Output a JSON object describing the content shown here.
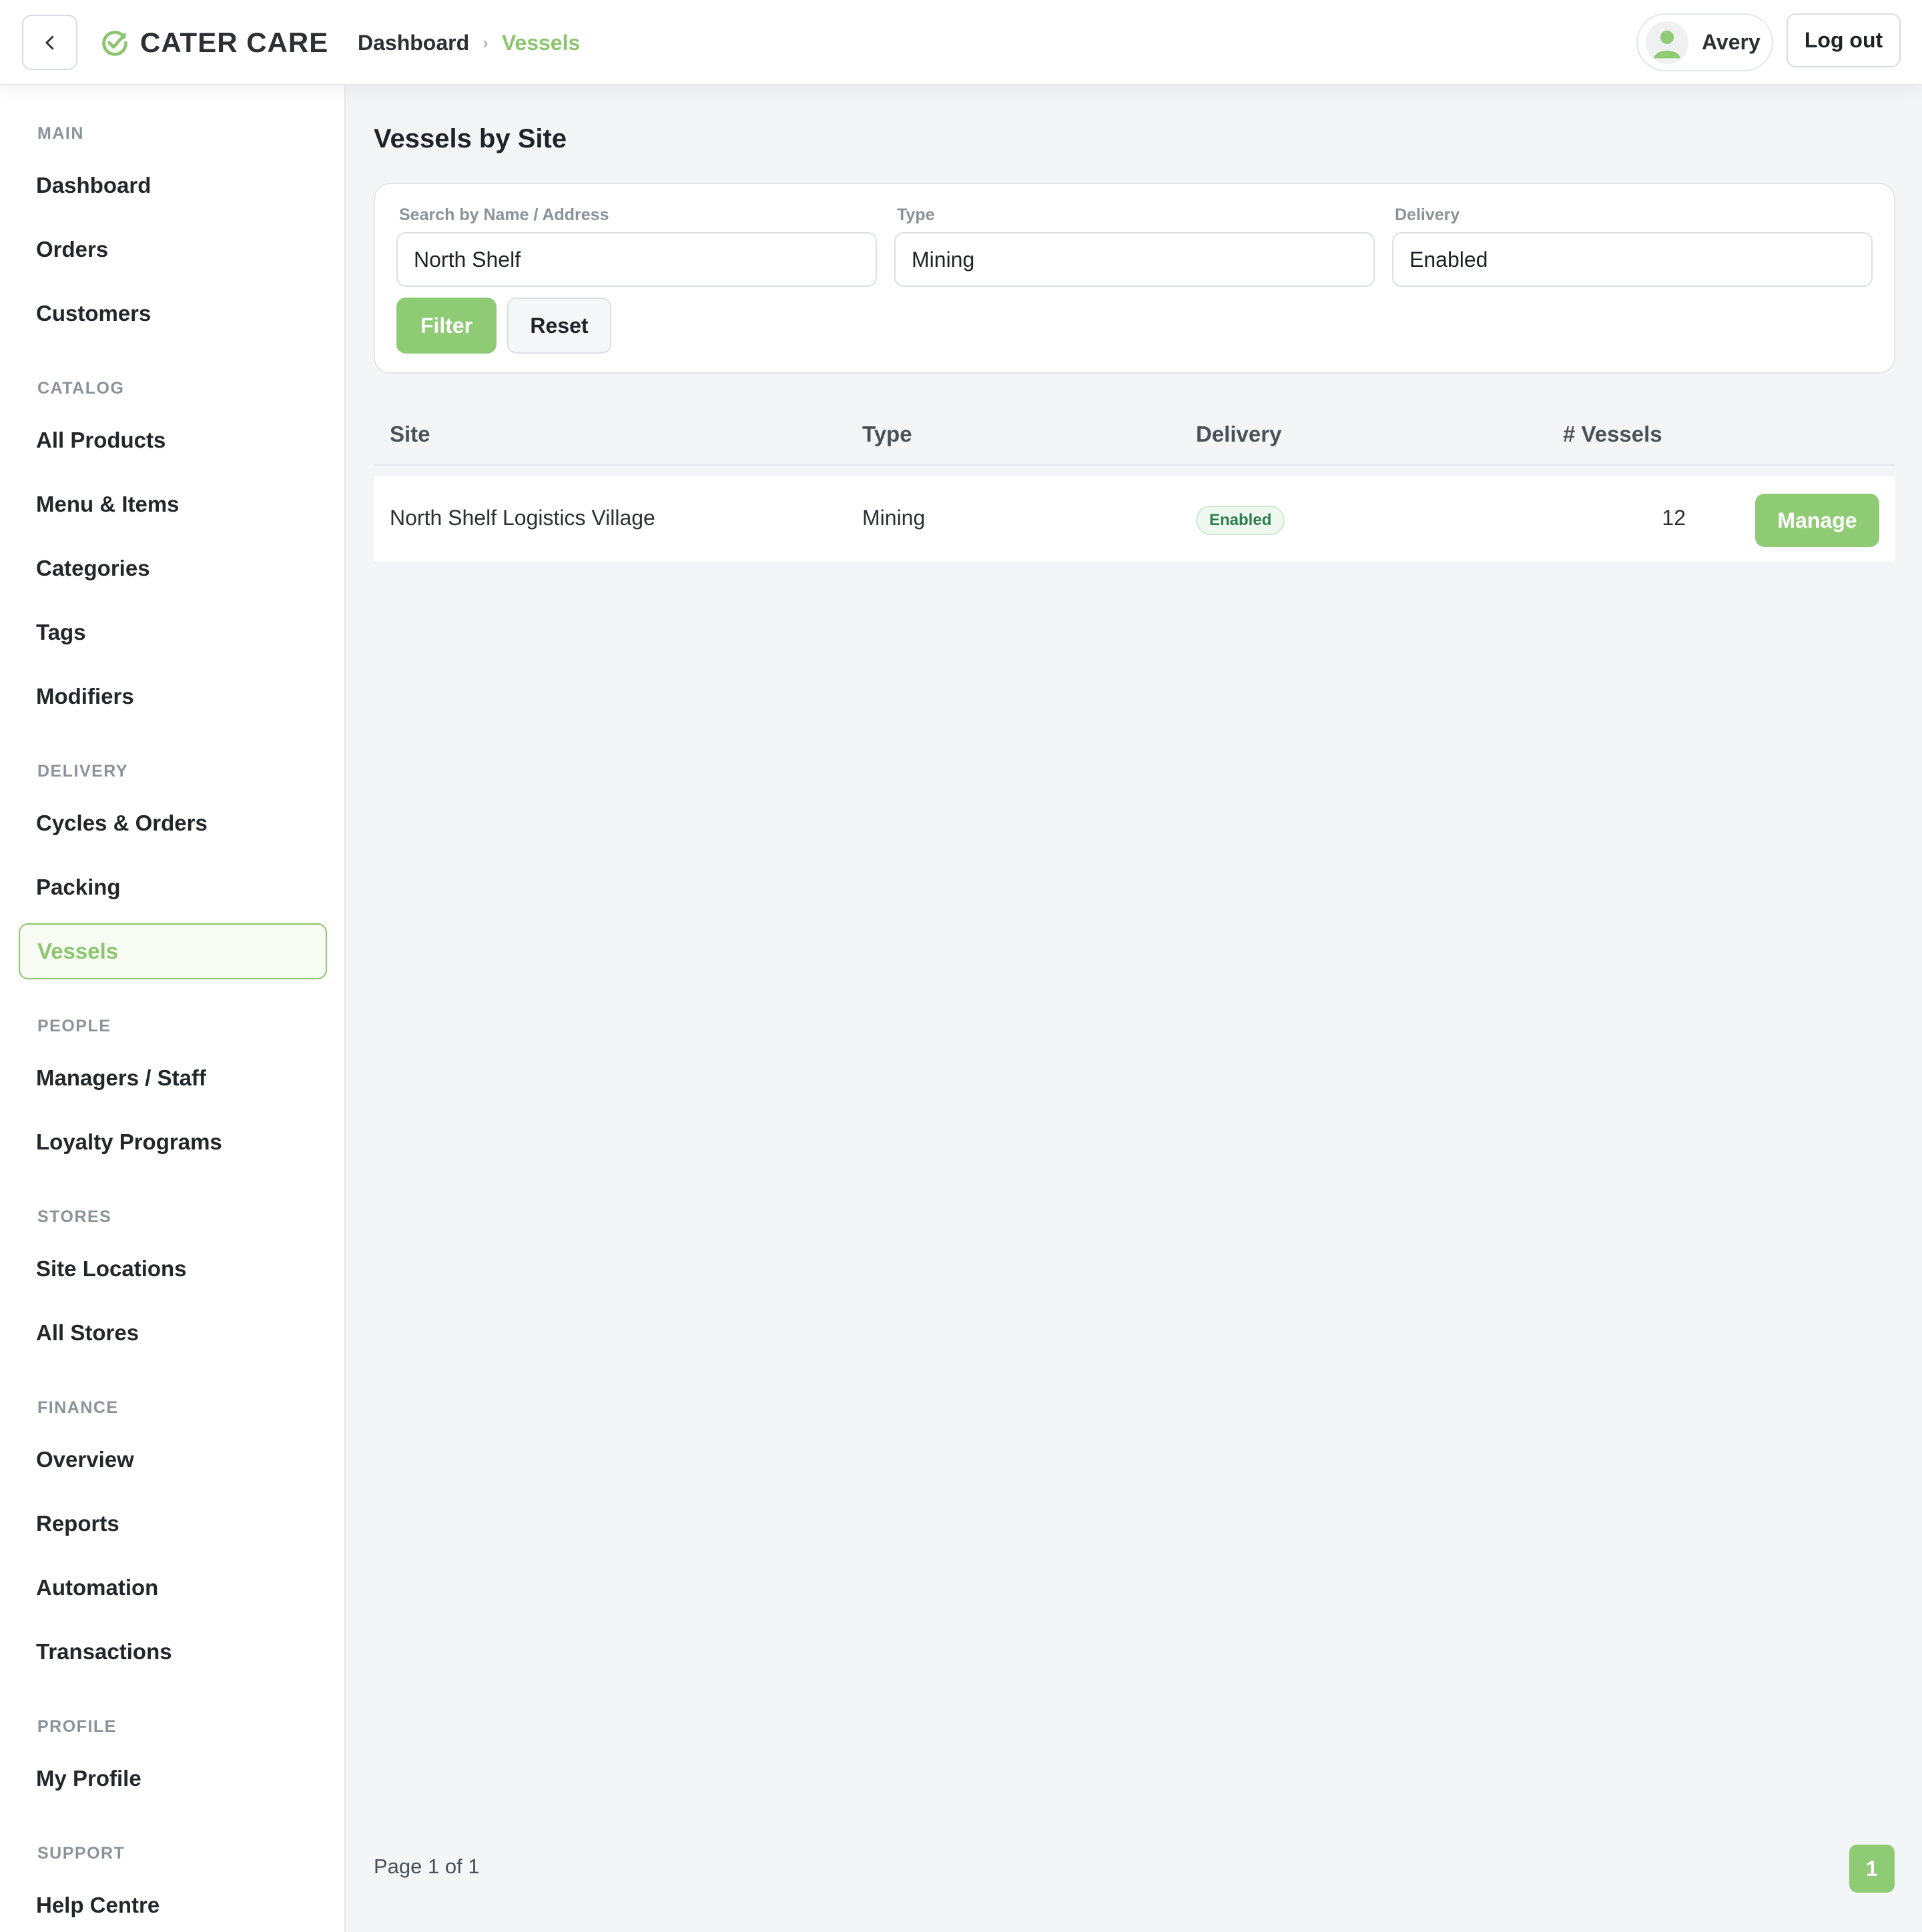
{
  "app": {
    "brand": "CATER CARE",
    "accent_color": "#8cc56d"
  },
  "header": {
    "breadcrumb": {
      "home": "Dashboard",
      "separator": "›",
      "current": "Vessels"
    },
    "user": {
      "name": "Avery",
      "avatar_icon": "user-icon"
    },
    "logout_label": "Log out",
    "back_icon": "chevron-left-icon"
  },
  "sidebar": {
    "sections": [
      {
        "title": "MAIN",
        "items": [
          "Dashboard",
          "Orders",
          "Customers"
        ]
      },
      {
        "title": "CATALOG",
        "items": [
          "All Products",
          "Menu & Items",
          "Categories",
          "Tags",
          "Modifiers"
        ]
      },
      {
        "title": "DELIVERY",
        "items": [
          "Cycles & Orders",
          "Packing",
          "Vessels"
        ]
      },
      {
        "title": "PEOPLE",
        "items": [
          "Managers / Staff",
          "Loyalty Programs"
        ]
      },
      {
        "title": "STORES",
        "items": [
          "Site Locations",
          "All Stores"
        ]
      },
      {
        "title": "FINANCE",
        "items": [
          "Overview",
          "Reports",
          "Automation",
          "Transactions"
        ]
      },
      {
        "title": "PROFILE",
        "items": [
          "My Profile"
        ]
      },
      {
        "title": "SUPPORT",
        "items": [
          "Help Centre"
        ]
      }
    ],
    "active_item": "Vessels"
  },
  "main": {
    "title": "Vessels by Site",
    "filters": {
      "search": {
        "label": "Search by Name / Address",
        "value": "North Shelf"
      },
      "type": {
        "label": "Type",
        "value": "Mining"
      },
      "delivery": {
        "label": "Delivery",
        "value": "Enabled"
      },
      "filter_label": "Filter",
      "reset_label": "Reset"
    },
    "table": {
      "columns": [
        "Site",
        "Type",
        "Delivery",
        "# Vessels"
      ],
      "rows": [
        {
          "site": "North Shelf Logistics Village",
          "type": "Mining",
          "delivery": "Enabled",
          "vessels": "12",
          "action": "Manage"
        }
      ]
    },
    "pagination": {
      "info": "Page 1 of 1",
      "current": "1"
    }
  }
}
